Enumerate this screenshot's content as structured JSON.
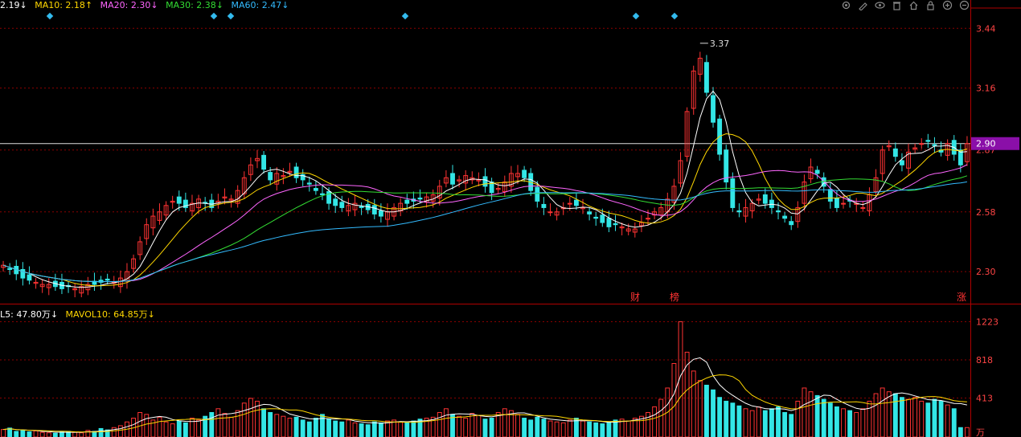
{
  "legend": {
    "ma5": {
      "text": "2.19↓",
      "color": "#ffffff"
    },
    "ma10": {
      "text": "MA10: 2.18↑",
      "color": "#ffd700"
    },
    "ma20": {
      "text": "MA20: 2.30↓",
      "color": "#ff66ff"
    },
    "ma30": {
      "text": "MA30: 2.38↓",
      "color": "#33dd33"
    },
    "ma60": {
      "text": "MA60: 2.47↓",
      "color": "#33bbff"
    },
    "vol": {
      "text": "L5: 47.80万↓",
      "color": "#ffffff"
    },
    "mavol10": {
      "text": "MAVOL10: 64.85万↓",
      "color": "#ffd700"
    }
  },
  "toolbar_icons": [
    "settings-icon",
    "pen-icon",
    "eye-icon",
    "trash-icon",
    "home-icon",
    "lock-icon",
    "zoom-in-icon",
    "zoom-out-icon"
  ],
  "price_axis": {
    "ticks": [
      "3.44",
      "3.16",
      "2.87",
      "2.58",
      "2.30"
    ],
    "current": "2.90",
    "current_color": "#8a0fa8"
  },
  "volume_axis": {
    "ticks": [
      "1223",
      "818",
      "413"
    ],
    "unit": "万"
  },
  "markers": {
    "high_label": "3.37",
    "events": [
      "财",
      "榜",
      "涨"
    ]
  },
  "colors": {
    "up": "#ff3333",
    "down": "#33e6e6",
    "grid": "#8b0000",
    "axis_text": "#ff4444",
    "diamond": "#33bbee"
  },
  "chart_data": {
    "type": "candlestick",
    "price_range": [
      2.15,
      3.52
    ],
    "volume_range": [
      0,
      1270
    ],
    "candles": [],
    "ma": {
      "ma5": {
        "name": "MA5",
        "color": "#ffffff"
      },
      "ma10": {
        "name": "MA10",
        "color": "#ffd700"
      },
      "ma20": {
        "name": "MA20",
        "color": "#ff66ff"
      },
      "ma30": {
        "name": "MA30",
        "color": "#33dd33"
      },
      "ma60": {
        "name": "MA60",
        "color": "#33bbff"
      }
    },
    "close_series": [
      2.33,
      2.31,
      2.29,
      2.27,
      2.26,
      2.25,
      2.24,
      2.24,
      2.23,
      2.22,
      2.23,
      2.22,
      2.23,
      2.24,
      2.24,
      2.25,
      2.26,
      2.25,
      2.27,
      2.3,
      2.36,
      2.44,
      2.52,
      2.56,
      2.58,
      2.61,
      2.63,
      2.62,
      2.6,
      2.62,
      2.64,
      2.62,
      2.6,
      2.63,
      2.65,
      2.64,
      2.68,
      2.74,
      2.8,
      2.83,
      2.78,
      2.73,
      2.76,
      2.75,
      2.77,
      2.74,
      2.73,
      2.71,
      2.68,
      2.66,
      2.62,
      2.61,
      2.6,
      2.61,
      2.62,
      2.6,
      2.59,
      2.57,
      2.56,
      2.58,
      2.6,
      2.62,
      2.62,
      2.63,
      2.64,
      2.65,
      2.66,
      2.7,
      2.74,
      2.71,
      2.73,
      2.75,
      2.74,
      2.73,
      2.7,
      2.67,
      2.69,
      2.72,
      2.76,
      2.76,
      2.74,
      2.68,
      2.63,
      2.6,
      2.58,
      2.58,
      2.6,
      2.62,
      2.61,
      2.6,
      2.57,
      2.55,
      2.53,
      2.51,
      2.52,
      2.51,
      2.5,
      2.5,
      2.53,
      2.55,
      2.58,
      2.6,
      2.64,
      2.7,
      2.82,
      3.05,
      3.24,
      3.3,
      3.14,
      3.0,
      2.85,
      2.72,
      2.6,
      2.58,
      2.6,
      2.62,
      2.64,
      2.62,
      2.6,
      2.58,
      2.55,
      2.52,
      2.6,
      2.72,
      2.79,
      2.76,
      2.7,
      2.63,
      2.6,
      2.62,
      2.63,
      2.62,
      2.6,
      2.66,
      2.74,
      2.87,
      2.89,
      2.84,
      2.8,
      2.86,
      2.88,
      2.9,
      2.91,
      2.89,
      2.86,
      2.9,
      2.85,
      2.8,
      2.9
    ],
    "volume_series": [
      80,
      95,
      60,
      70,
      55,
      65,
      50,
      45,
      40,
      55,
      60,
      50,
      45,
      70,
      60,
      90,
      75,
      100,
      120,
      160,
      200,
      260,
      240,
      180,
      210,
      160,
      140,
      170,
      150,
      200,
      180,
      220,
      260,
      300,
      250,
      210,
      280,
      360,
      410,
      380,
      300,
      260,
      240,
      220,
      200,
      210,
      180,
      160,
      200,
      240,
      190,
      170,
      160,
      180,
      150,
      140,
      130,
      160,
      150,
      170,
      180,
      160,
      150,
      170,
      190,
      200,
      210,
      260,
      300,
      240,
      220,
      200,
      250,
      230,
      190,
      200,
      260,
      300,
      280,
      240,
      200,
      180,
      210,
      190,
      170,
      160,
      150,
      180,
      200,
      170,
      160,
      150,
      140,
      160,
      180,
      190,
      170,
      200,
      220,
      260,
      320,
      400,
      520,
      780,
      1223,
      900,
      700,
      600,
      550,
      500,
      420,
      380,
      360,
      330,
      300,
      280,
      320,
      280,
      300,
      320,
      260,
      240,
      380,
      520,
      480,
      440,
      400,
      360,
      320,
      300,
      280,
      260,
      300,
      380,
      460,
      520,
      480,
      460,
      420,
      400,
      420,
      380,
      360,
      400,
      380,
      340,
      300
    ]
  }
}
